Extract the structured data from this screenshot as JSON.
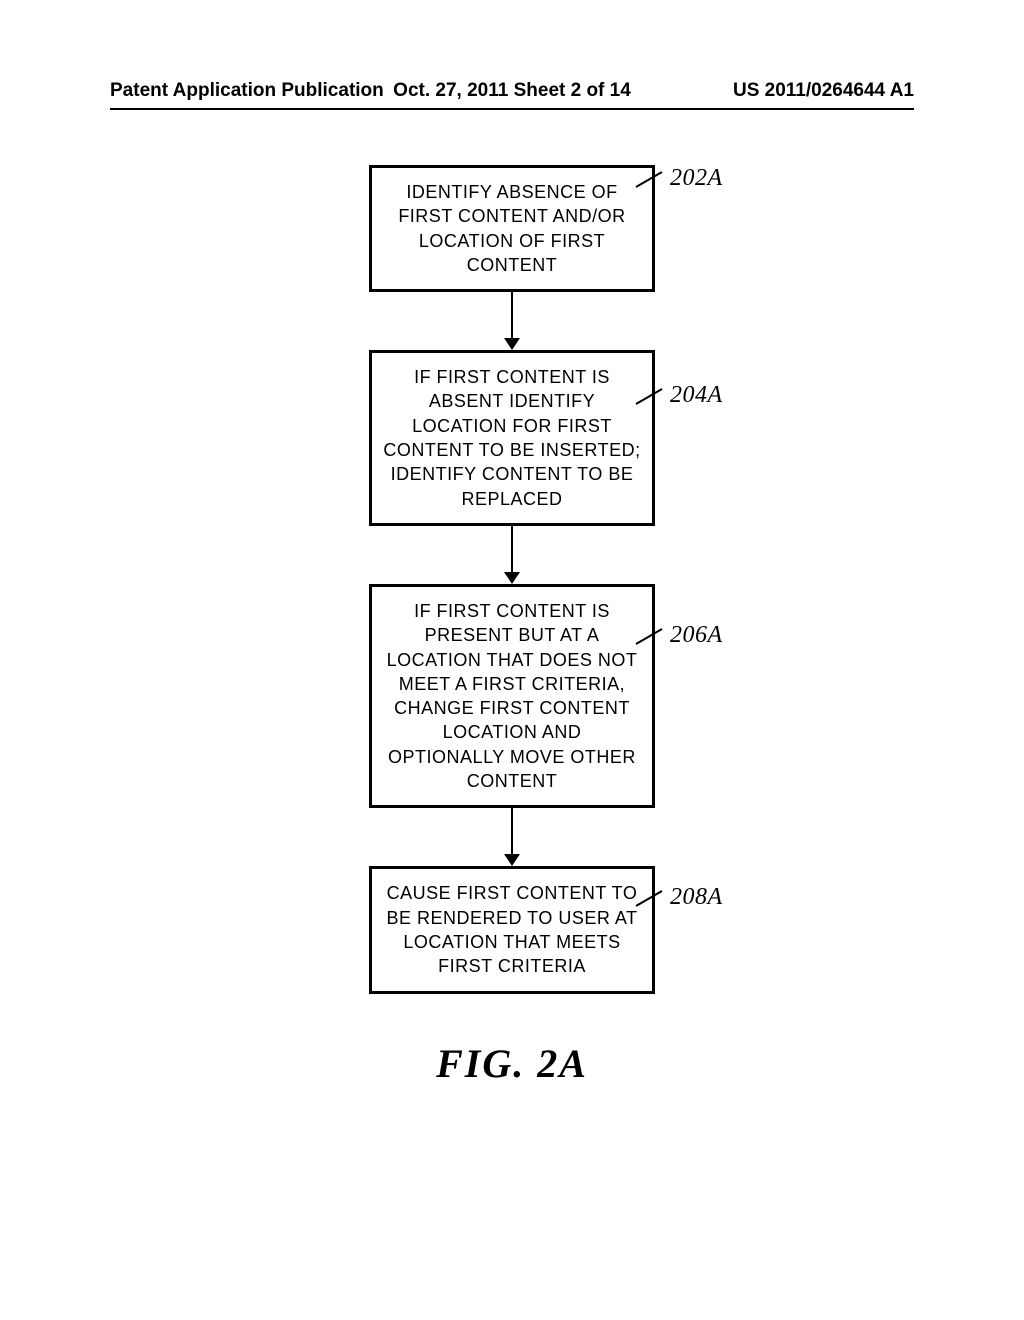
{
  "header": {
    "left": "Patent Application Publication",
    "center": "Oct. 27, 2011  Sheet 2 of 14",
    "right": "US 2011/0264644 A1"
  },
  "flow": {
    "boxes": [
      {
        "text": "IDENTIFY ABSENCE OF FIRST CONTENT AND/OR LOCATION OF FIRST CONTENT",
        "label": "202A"
      },
      {
        "text": "IF FIRST CONTENT IS ABSENT IDENTIFY LOCATION FOR FIRST CONTENT TO BE INSERTED; IDENTIFY CONTENT TO BE REPLACED",
        "label": "204A"
      },
      {
        "text": "IF FIRST CONTENT IS PRESENT BUT AT A LOCATION THAT DOES NOT MEET A FIRST CRITERIA, CHANGE FIRST CONTENT LOCATION AND OPTIONALLY MOVE OTHER CONTENT",
        "label": "206A"
      },
      {
        "text": "CAUSE FIRST CONTENT TO BE RENDERED TO USER AT LOCATION THAT MEETS FIRST CRITERIA",
        "label": "208A"
      }
    ]
  },
  "figure_caption": "FIG.  2A"
}
